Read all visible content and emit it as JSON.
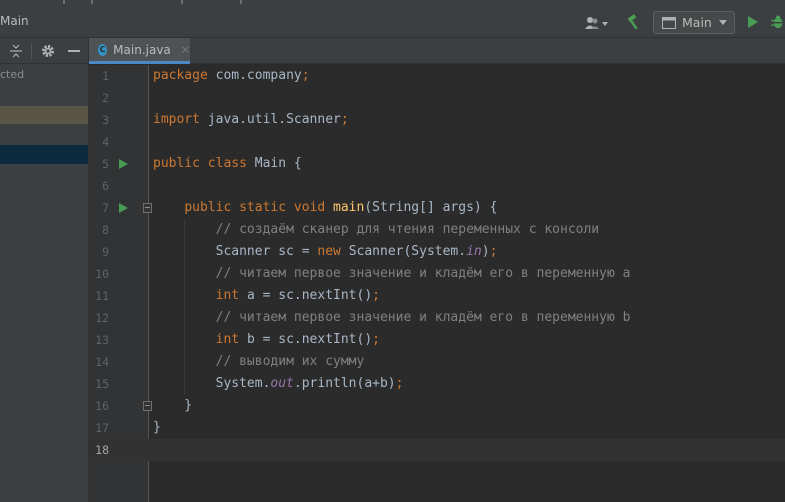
{
  "toolbar": {
    "project_label": "Main",
    "run_config": "Main"
  },
  "left_panel": {
    "tree_fragment": "cted"
  },
  "tab": {
    "label": "Main.java",
    "close": "×",
    "icon_letter": "C"
  },
  "colors": {
    "background": "#2b2b2b",
    "keyword": "#cc7832",
    "comment": "#808080",
    "function": "#ffc66d",
    "static_field": "#9876aa",
    "run_arrow": "#499c54",
    "tab_underline": "#4a88c7"
  },
  "editor": {
    "current_line": 18,
    "lines": [
      {
        "num": "1",
        "parts": [
          [
            "kw",
            "package "
          ],
          [
            "",
            ""
          ],
          [
            "",
            "com.company"
          ],
          [
            "kw",
            ";"
          ]
        ]
      },
      {
        "num": "2",
        "parts": []
      },
      {
        "num": "3",
        "parts": [
          [
            "kw",
            "import "
          ],
          [
            "",
            "java.util.Scanner"
          ],
          [
            "kw",
            ";"
          ]
        ]
      },
      {
        "num": "4",
        "parts": []
      },
      {
        "num": "5",
        "run": true,
        "parts": [
          [
            "kw",
            "public class "
          ],
          [
            "",
            "Main {"
          ]
        ]
      },
      {
        "num": "6",
        "parts": []
      },
      {
        "num": "7",
        "run": true,
        "fold": true,
        "parts": [
          [
            "",
            "    "
          ],
          [
            "kw",
            "public static void "
          ],
          [
            "fn",
            "main"
          ],
          [
            "",
            "(String[] args) {"
          ]
        ]
      },
      {
        "num": "8",
        "parts": [
          [
            "",
            "        "
          ],
          [
            "cm",
            "// создаём сканер для чтения переменных с консоли"
          ]
        ]
      },
      {
        "num": "9",
        "parts": [
          [
            "",
            "        Scanner sc = "
          ],
          [
            "kw",
            "new "
          ],
          [
            "",
            "Scanner(System."
          ],
          [
            "st",
            "in"
          ],
          [
            "",
            ")"
          ],
          [
            "kw",
            ";"
          ]
        ]
      },
      {
        "num": "10",
        "parts": [
          [
            "",
            "        "
          ],
          [
            "cm",
            "// читаем первое значение и кладём его в переменную a"
          ]
        ]
      },
      {
        "num": "11",
        "parts": [
          [
            "",
            "        "
          ],
          [
            "kw",
            "int "
          ],
          [
            "",
            "a = sc.nextInt()"
          ],
          [
            "kw",
            ";"
          ]
        ]
      },
      {
        "num": "12",
        "parts": [
          [
            "",
            "        "
          ],
          [
            "cm",
            "// читаем первое значение и кладём его в переменную b"
          ]
        ]
      },
      {
        "num": "13",
        "parts": [
          [
            "",
            "        "
          ],
          [
            "kw",
            "int "
          ],
          [
            "",
            "b = sc.nextInt()"
          ],
          [
            "kw",
            ";"
          ]
        ]
      },
      {
        "num": "14",
        "parts": [
          [
            "",
            "        "
          ],
          [
            "cm",
            "// выводим их сумму"
          ]
        ]
      },
      {
        "num": "15",
        "parts": [
          [
            "",
            "        System."
          ],
          [
            "st",
            "out"
          ],
          [
            "",
            ".println(a+b)"
          ],
          [
            "kw",
            ";"
          ]
        ]
      },
      {
        "num": "16",
        "fold": true,
        "parts": [
          [
            "",
            "    }"
          ]
        ]
      },
      {
        "num": "17",
        "parts": [
          [
            "",
            "}"
          ]
        ]
      },
      {
        "num": "18",
        "parts": []
      }
    ]
  }
}
